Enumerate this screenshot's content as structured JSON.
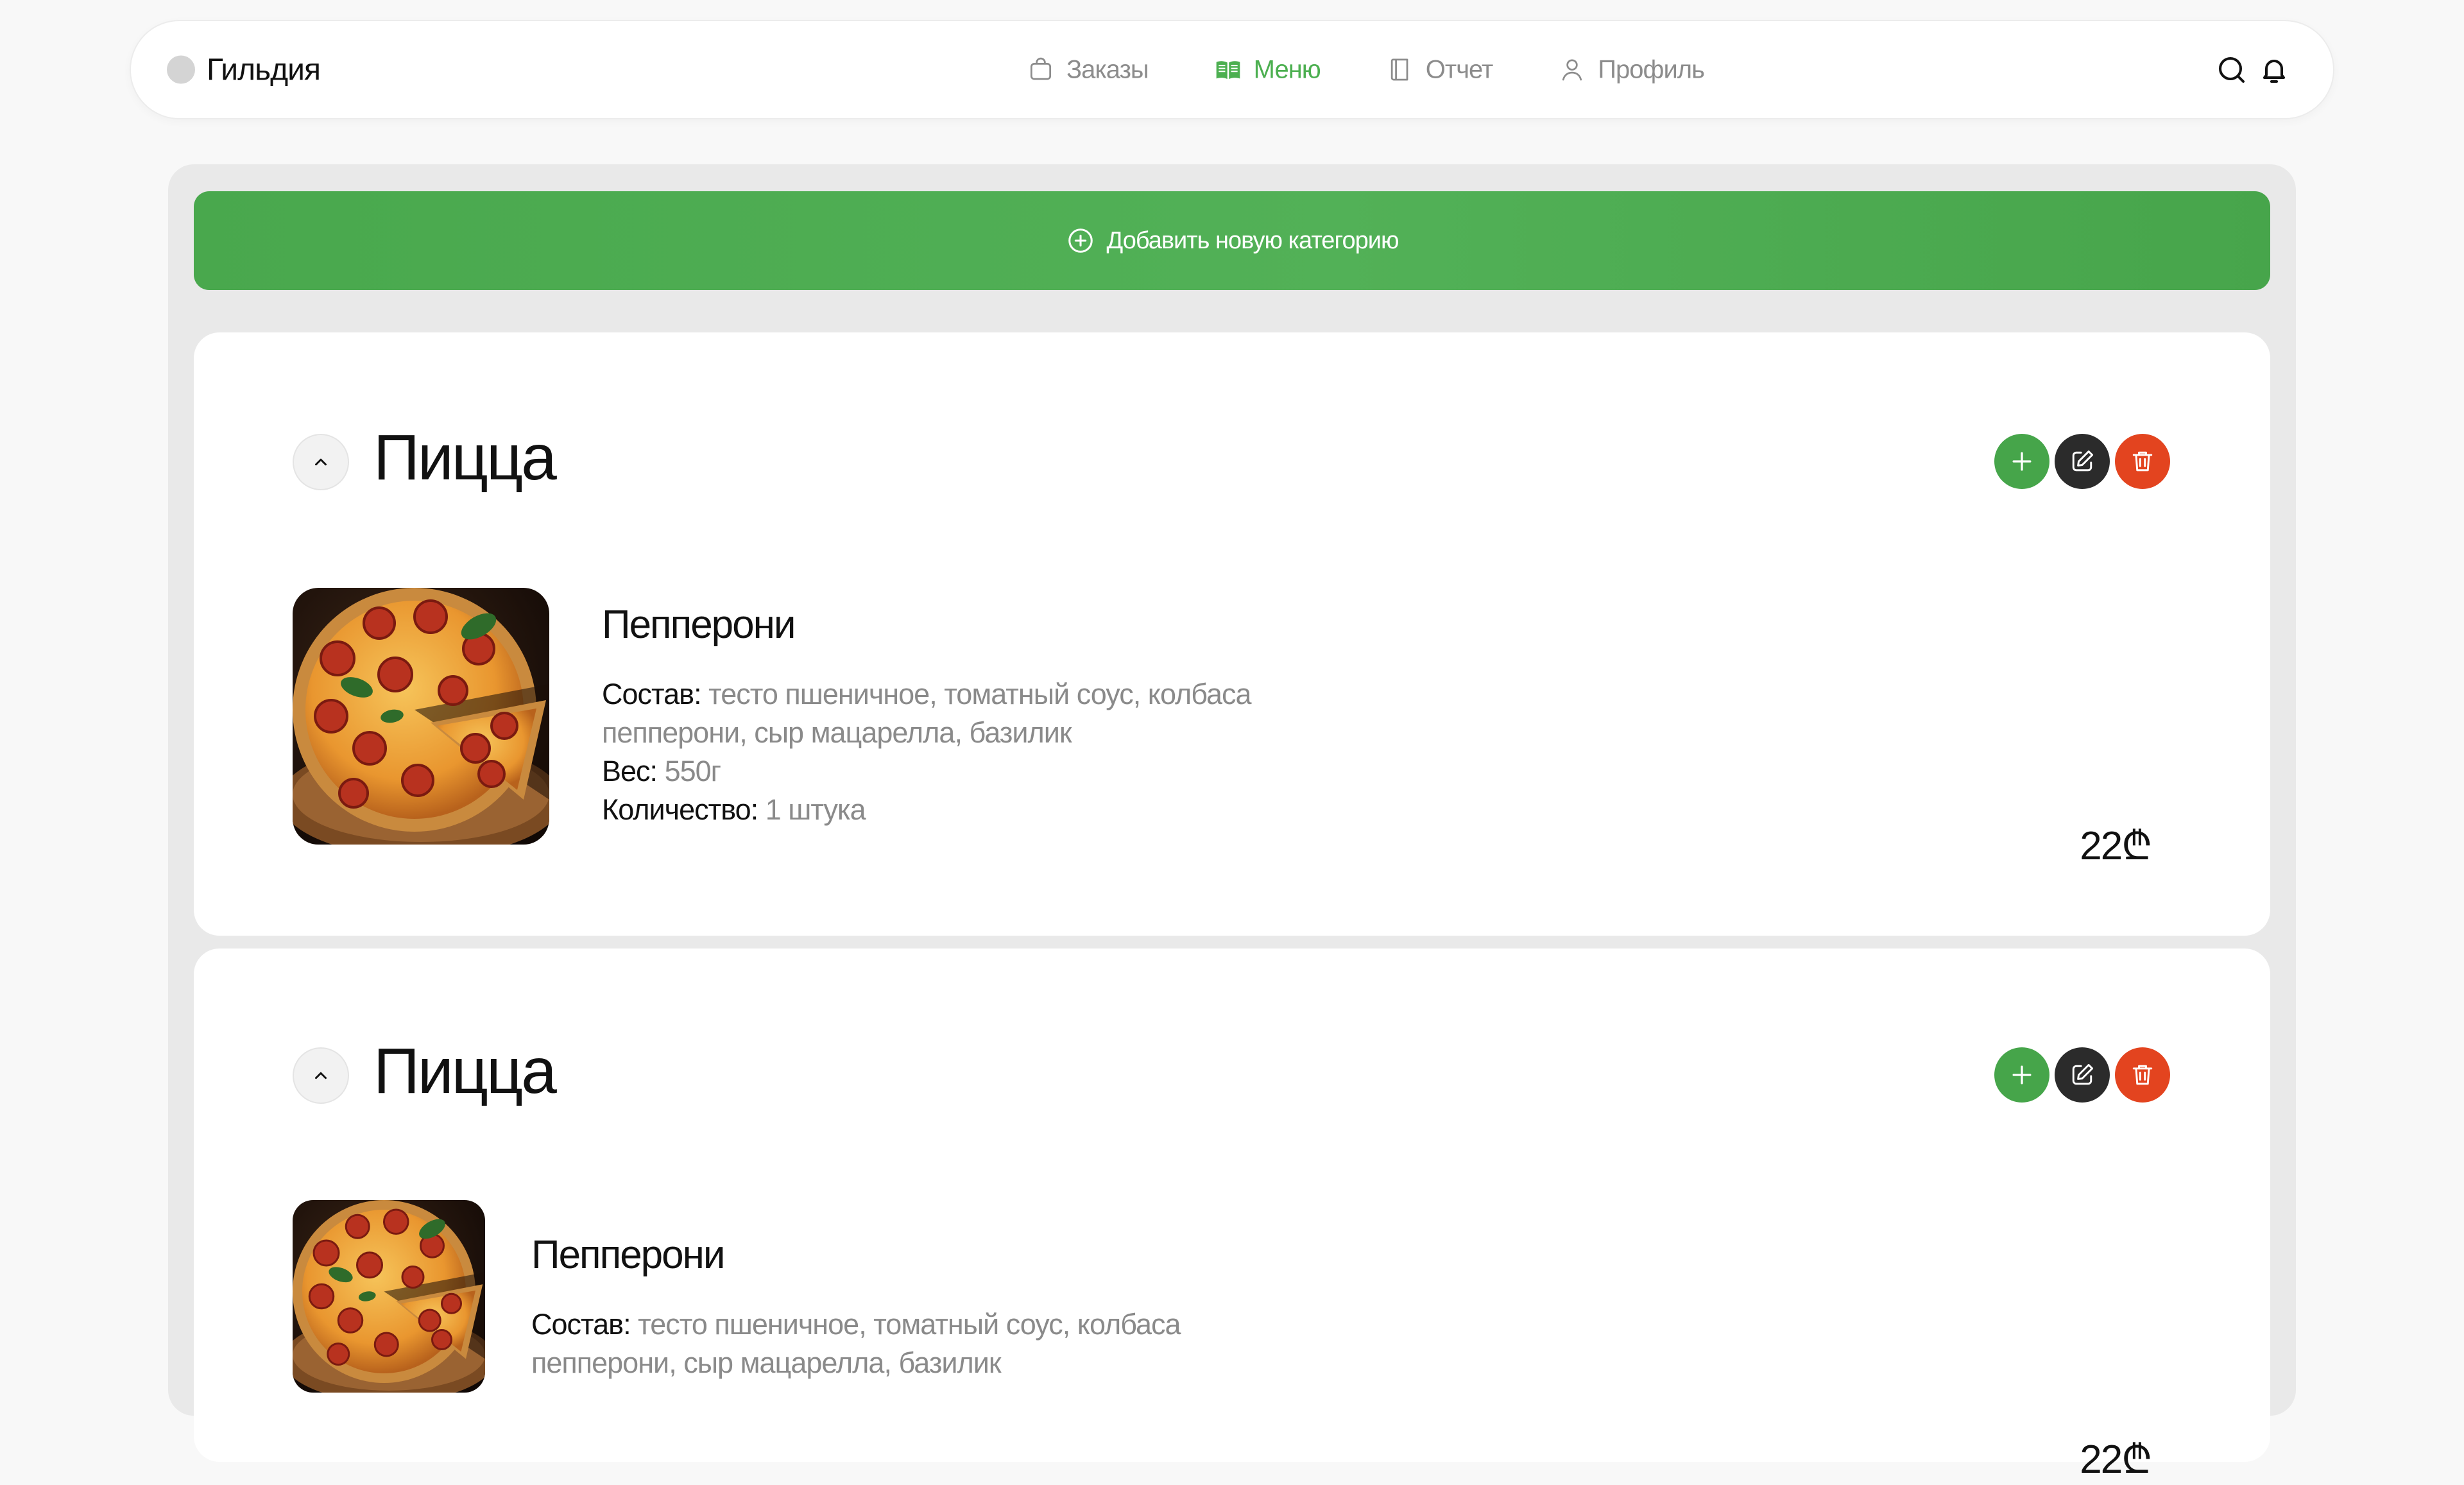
{
  "header": {
    "brand": "Гильдия",
    "nav": [
      {
        "label": "Заказы",
        "icon": "bag-icon",
        "active": false
      },
      {
        "label": "Меню",
        "icon": "menu-book-icon",
        "active": true
      },
      {
        "label": "Отчет",
        "icon": "report-book-icon",
        "active": false
      },
      {
        "label": "Профиль",
        "icon": "user-icon",
        "active": false
      }
    ],
    "tools": [
      "search-icon",
      "bell-icon"
    ]
  },
  "add_category_label": "Добавить новую категорию",
  "colors": {
    "accent": "#4caf50",
    "add_button": "#46a54a",
    "edit_button": "#2b2b2b",
    "delete_button": "#e3441f",
    "muted_text": "#8a8a8a"
  },
  "categories": [
    {
      "title": "Пицца",
      "items": [
        {
          "name": "Пепперони",
          "composition_label": "Состав:",
          "composition": "тесто пшеничное, томатный соус, колбаса пепперони, сыр мацарелла, базилик",
          "composition_line1": "тесто пшеничное, томатный соус, колбаса",
          "composition_line2": "пепперони, сыр мацарелла, базилик",
          "weight_label": "Вес:",
          "weight": "550г",
          "quantity_label": "Количество:",
          "quantity": "1 штука",
          "price": "22₾"
        }
      ]
    },
    {
      "title": "Пицца",
      "items": [
        {
          "name": "Пепперони",
          "composition_label": "Состав:",
          "composition": "тесто пшеничное, томатный соус, колбаса пепперони, сыр мацарелла, базилик",
          "composition_line1": "тесто пшеничное, томатный соус, колбаса",
          "composition_line2": "пепперони, сыр мацарелла, базилик",
          "price": "22₾"
        }
      ]
    }
  ]
}
